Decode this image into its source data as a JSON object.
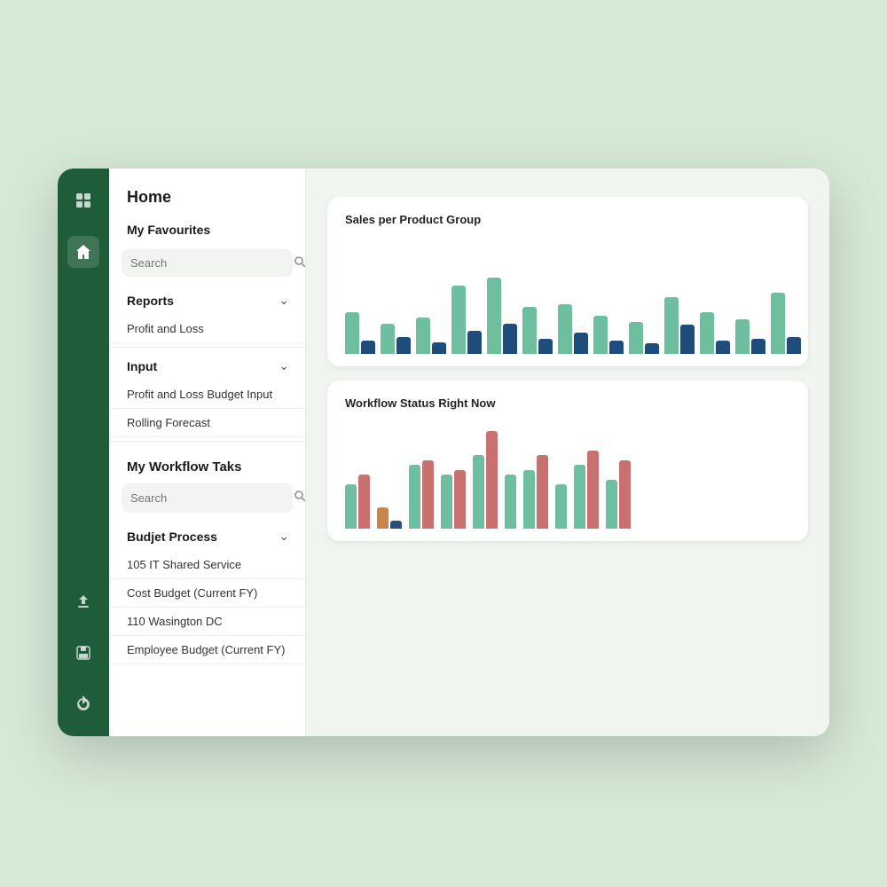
{
  "sidebar": {
    "icons": [
      {
        "name": "grid-icon",
        "symbol": "⊞",
        "active": false
      },
      {
        "name": "home-icon",
        "symbol": "⌂",
        "active": true
      }
    ],
    "bottom_icons": [
      {
        "name": "upload-icon",
        "symbol": "↑"
      },
      {
        "name": "save-icon",
        "symbol": "💾"
      },
      {
        "name": "refresh-icon",
        "symbol": "↺"
      }
    ]
  },
  "header": {
    "title": "Home"
  },
  "favourites": {
    "section_title": "My Favourites",
    "search_placeholder": "Search",
    "reports_label": "Reports",
    "profit_and_loss_label": "Profit and Loss",
    "input_label": "Input",
    "profit_loss_budget_label": "Profit and Loss Budget Input",
    "rolling_forecast_label": "Rolling Forecast"
  },
  "workflow": {
    "section_title": "My Workflow Taks",
    "search_placeholder": "Search",
    "budget_process_label": "Budjet Process",
    "items": [
      "105 IT Shared Service",
      "Cost Budget (Current FY)",
      "110 Wasington DC",
      "Employee Budget (Current FY)"
    ]
  },
  "charts": {
    "sales_chart": {
      "title": "Sales per Product Group",
      "bars": [
        {
          "teal": 55,
          "dark": 18
        },
        {
          "teal": 40,
          "dark": 22
        },
        {
          "teal": 48,
          "dark": 15
        },
        {
          "teal": 90,
          "dark": 30
        },
        {
          "teal": 100,
          "dark": 40
        },
        {
          "teal": 62,
          "dark": 20
        },
        {
          "teal": 65,
          "dark": 28
        },
        {
          "teal": 50,
          "dark": 18
        },
        {
          "teal": 42,
          "dark": 14
        },
        {
          "teal": 75,
          "dark": 38
        },
        {
          "teal": 55,
          "dark": 18
        },
        {
          "teal": 45,
          "dark": 20
        },
        {
          "teal": 80,
          "dark": 22
        }
      ]
    },
    "workflow_chart": {
      "title": "Workflow Status Right Now",
      "bars": [
        {
          "green": 45,
          "red": 55,
          "orange": 0,
          "blue": 0
        },
        {
          "green": 0,
          "red": 0,
          "orange": 22,
          "blue": 8
        },
        {
          "green": 65,
          "red": 70,
          "orange": 0,
          "blue": 0
        },
        {
          "green": 55,
          "red": 60,
          "orange": 0,
          "blue": 0
        },
        {
          "green": 75,
          "red": 100,
          "orange": 0,
          "blue": 0
        },
        {
          "green": 55,
          "red": 0,
          "orange": 0,
          "blue": 0
        },
        {
          "green": 60,
          "red": 75,
          "orange": 0,
          "blue": 0
        },
        {
          "green": 45,
          "red": 0,
          "orange": 0,
          "blue": 0
        },
        {
          "green": 65,
          "red": 80,
          "orange": 0,
          "blue": 0
        },
        {
          "green": 50,
          "red": 70,
          "orange": 0,
          "blue": 0
        }
      ]
    }
  }
}
